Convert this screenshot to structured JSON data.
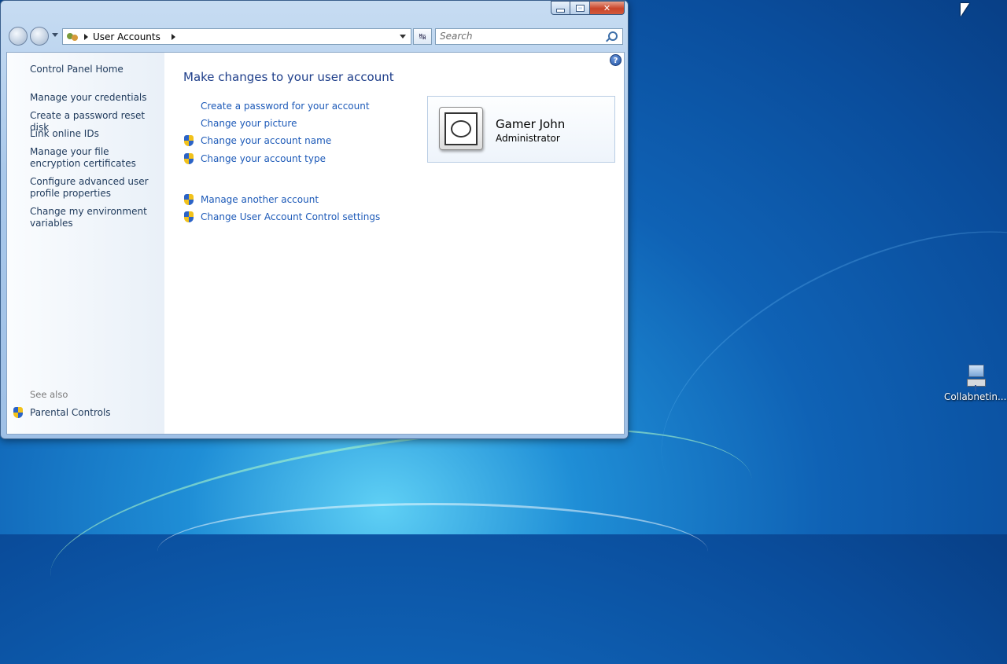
{
  "address_bar": {
    "path": "User Accounts"
  },
  "search": {
    "placeholder": "Search"
  },
  "sidebar": {
    "items": [
      {
        "label": "Control Panel Home"
      },
      {
        "label": "Manage your credentials"
      },
      {
        "label": "Create a password reset disk"
      },
      {
        "label": "Link online IDs"
      },
      {
        "label": "Manage your file encryption certificates"
      },
      {
        "label": "Configure advanced user profile properties"
      },
      {
        "label": "Change my environment variables"
      }
    ],
    "see_also_heading": "See also",
    "see_also_items": [
      {
        "label": "Parental Controls",
        "icon": "uac-shield-icon"
      }
    ]
  },
  "main": {
    "title": "Make changes to your user account",
    "tasks": [
      {
        "label": "Create a password for your account",
        "icon": null
      },
      {
        "label": "Change your picture",
        "icon": null
      },
      {
        "label": "Change your account name",
        "icon": "uac-shield-icon"
      },
      {
        "label": "Change your account type",
        "icon": "uac-shield-icon"
      }
    ],
    "other_tasks": [
      {
        "label": "Manage another account",
        "icon": "uac-shield-icon"
      },
      {
        "label": "Change User Account Control settings",
        "icon": "uac-shield-icon"
      }
    ]
  },
  "user_card": {
    "name": "Gamer John",
    "role": "Administrator"
  },
  "desktop": {
    "icons": [
      {
        "label": "Collabnetin...",
        "icon": "network-computer-icon"
      }
    ]
  },
  "colors": {
    "link": "#1d5ab8",
    "title": "#1e3e8a",
    "sidebar_text": "#1e395b",
    "close_button": "#c9442a"
  }
}
